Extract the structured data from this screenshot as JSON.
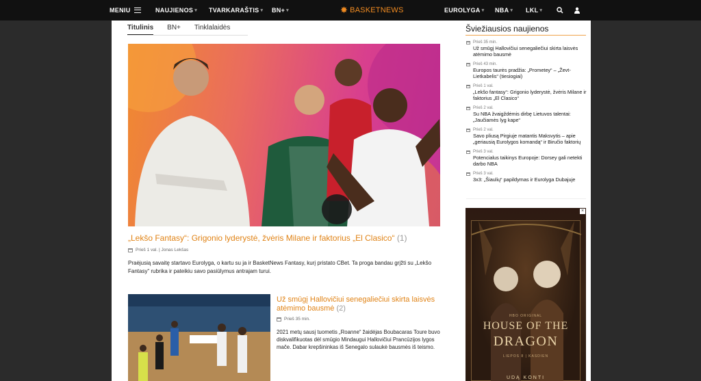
{
  "nav": {
    "menu_label": "MENIU",
    "items_left": [
      {
        "label": "NAUJIENOS"
      },
      {
        "label": "TVARKARAŠTIS"
      },
      {
        "label": "BN+"
      }
    ],
    "logo_a": "BASKET",
    "logo_b": "NEWS",
    "items_right": [
      {
        "label": "EUROLYGA"
      },
      {
        "label": "NBA"
      },
      {
        "label": "LKL"
      }
    ],
    "brand_color": "#f18b21"
  },
  "tabs": [
    {
      "label": "Titulinis",
      "active": true
    },
    {
      "label": "BN+"
    },
    {
      "label": "Tinklalaidės"
    }
  ],
  "hero": {
    "title": "„Lekšo Fantasy“: Grigonio lyderystė, žvėris Milane ir faktorius „El Clasico“",
    "comments": "(1)",
    "meta": "Prieš 1 val. | Jonas Lekšas",
    "description": "Praėjusią savaitę startavo Eurolyga, o kartu su ja ir BasketNews Fantasy, kurį pristato CBet. Ta proga bandau grįžti su „Lekšo Fantasy“ rubrika ir pateikiu savo pasiūlymus antrajam turui."
  },
  "article2": {
    "title": "Už smūgį Hallovičiui senegaliečiui skirta laisvės atėmimo bausmė",
    "comments": "(2)",
    "meta": "Prieš 35 min.",
    "description": "2021 metų sausį tuometis „Roanne“ žaidėjas Boubacaras Toure buvo diskvalifikuotas dėl smūgio Mindaugui Hallovičiui Prancūzijos lygos mače. Dabar krepšininkas iš Senegalo sulaukė bausmės iš teismo."
  },
  "sidebar": {
    "title": "Šviežiausios naujienos",
    "news": [
      {
        "time": "Prieš 35 min.",
        "text": "Už smūgį Hallovičiui senegaliečiui skirta laisvės atėmimo bausmė"
      },
      {
        "time": "Prieš 43 min.",
        "text": "Europos taurės pradžia: „Prometey“ – „Ževt-Lietkabelis“ (tiesiogiai)"
      },
      {
        "time": "Prieš 1 val.",
        "text": "„Lekšo fantasy“: Grigonio lyderystė, žvėris Milane ir faktorius „El Clasico“"
      },
      {
        "time": "Prieš 2 val.",
        "text": "Su NBA žvaigždėmis dirbę Lietuvos talentai: „Jaučiamės lyg kape“"
      },
      {
        "time": "Prieš 2 val.",
        "text": "Savo pliusą Pirgiuje matantis Maksvytis – apie „geriausią Eurolygos komandą“ ir Biručio faktorių"
      },
      {
        "time": "Prieš 3 val.",
        "text": "Potencialus taikinys Europoje: Dorsey gali netekti darbo NBA"
      },
      {
        "time": "Prieš 3 val.",
        "text": "3x3: „Šiaulių“ papildymas ir Eurolyga Dubajuje"
      }
    ]
  },
  "ad": {
    "close": "×",
    "network": "HBO ORIGINAL",
    "house": "HOUSE OF THE",
    "dragon": "DRAGON",
    "sub": "LIEPOS 8 | KASDIEN",
    "bottom": "UDĄ KONTI"
  }
}
